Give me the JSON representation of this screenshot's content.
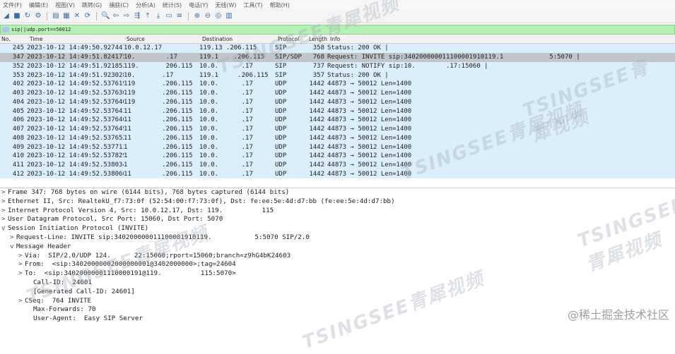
{
  "menu": [
    "文件(F)",
    "编辑(E)",
    "视图(V)",
    "跳转(G)",
    "捕获(C)",
    "分析(A)",
    "统计(S)",
    "电话(Y)",
    "无线(W)",
    "工具(T)",
    "帮助(H)"
  ],
  "filter": {
    "value": "sip||udp.port==50012"
  },
  "columns": {
    "no": "No.",
    "time": "Time",
    "source": "Source",
    "destination": "Destination",
    "protocol": "Protocol",
    "length": "Length",
    "info": "Info"
  },
  "packets": [
    {
      "no": "245",
      "time": "2023-10-12 14:49:50.927447",
      "src": "10.0.12.17",
      "dst": "119.13 .206.115",
      "proto": "SIP",
      "len": "358",
      "info": "Status: 200 OK |"
    },
    {
      "no": "347",
      "time": "2023-10-12 14:49:51.824175",
      "src": "10.        .17",
      "dst": "119.1    .206.115",
      "proto": "SIP/SDP",
      "len": "768",
      "info": "Request: INVITE sip:340200000011100001910119.1            5:5070 |"
    },
    {
      "no": "352",
      "time": "2023-10-12 14:49:51.921852",
      "src": "119.       206.115",
      "dst": "10.0.      .17",
      "proto": "SIP",
      "len": "737",
      "info": "Request: NOTIFY sip:10.        .17:15060 |"
    },
    {
      "no": "353",
      "time": "2023-10-12 14:49:51.923028",
      "src": "10.       .17",
      "dst": "119.1     .206.115",
      "proto": "SIP",
      "len": "357",
      "info": "Status: 200 OK |"
    },
    {
      "no": "402",
      "time": "2023-10-12 14:49:52.537619",
      "src": "119       .206.115",
      "dst": "10.0.      .17",
      "proto": "UDP",
      "len": "1442",
      "info": "44873 → 50012 Len=1400"
    },
    {
      "no": "403",
      "time": "2023-10-12 14:49:52.537636",
      "src": "119       .206.115",
      "dst": "10.0.      .17",
      "proto": "UDP",
      "len": "1442",
      "info": "44873 → 50012 Len=1400"
    },
    {
      "no": "404",
      "time": "2023-10-12 14:49:52.537640",
      "src": "119       .206.115",
      "dst": "10.0.      .17",
      "proto": "UDP",
      "len": "1442",
      "info": "44873 → 50012 Len=1400"
    },
    {
      "no": "405",
      "time": "2023-10-12 14:49:52.537643",
      "src": "11        .206.115",
      "dst": "10.0.      .17",
      "proto": "UDP",
      "len": "1442",
      "info": "44873 → 50012 Len=1400"
    },
    {
      "no": "406",
      "time": "2023-10-12 14:49:52.537646",
      "src": "11        .206.115",
      "dst": "10.0.      .17",
      "proto": "UDP",
      "len": "1442",
      "info": "44873 → 50012 Len=1400"
    },
    {
      "no": "407",
      "time": "2023-10-12 14:49:52.537649",
      "src": "11        .206.115",
      "dst": "10.0.      .17",
      "proto": "UDP",
      "len": "1442",
      "info": "44873 → 50012 Len=1400"
    },
    {
      "no": "408",
      "time": "2023-10-12 14:49:52.537652",
      "src": "11        .206.115",
      "dst": "10.0.      .17",
      "proto": "UDP",
      "len": "1442",
      "info": "44873 → 50012 Len=1400"
    },
    {
      "no": "409",
      "time": "2023-10-12 14:49:52.537713",
      "src": "1         .206.115",
      "dst": "10.0.      .17",
      "proto": "UDP",
      "len": "1442",
      "info": "44873 → 50012 Len=1400"
    },
    {
      "no": "410",
      "time": "2023-10-12 14:49:52.537829",
      "src": "1         .206.115",
      "dst": "10.0.      .17",
      "proto": "UDP",
      "len": "1442",
      "info": "44873 → 50012 Len=1400"
    },
    {
      "no": "411",
      "time": "2023-10-12 14:49:52.538034",
      "src": "1         .206.115",
      "dst": "10.0.      .17",
      "proto": "UDP",
      "len": "1442",
      "info": "44873 → 50012 Len=1400"
    },
    {
      "no": "412",
      "time": "2023-10-12 14:49:52.538066",
      "src": "11        .206.115",
      "dst": "10.0.      .17",
      "proto": "UDP",
      "len": "1442",
      "info": "44873 → 50012 Len=1400"
    }
  ],
  "details": [
    {
      "indent": 0,
      "arrow": ">",
      "text": "Frame 347: 768 bytes on wire (6144 bits), 768 bytes captured (6144 bits)"
    },
    {
      "indent": 0,
      "arrow": ">",
      "text": "Ethernet II, Src: RealtekU_f7:73:0f (52:54:00:f7:73:0f), Dst: fe:ee:5e:4d:d7:bb (fe:ee:5e:4d:d7:bb)"
    },
    {
      "indent": 0,
      "arrow": ">",
      "text": "Internet Protocol Version 4, Src: 10.0.12.17, Dst: 119.          115"
    },
    {
      "indent": 0,
      "arrow": ">",
      "text": "User Datagram Protocol, Src Port: 15060, Dst Port: 5070"
    },
    {
      "indent": 0,
      "arrow": "v",
      "text": "Session Initiation Protocol (INVITE)"
    },
    {
      "indent": 1,
      "arrow": ">",
      "text": "Request-Line: INVITE sip:340200000011100001910119.           5:5070 SIP/2.0"
    },
    {
      "indent": 1,
      "arrow": "v",
      "text": "Message Header"
    },
    {
      "indent": 2,
      "arrow": ">",
      "text": "Via:  SIP/2.0/UDP 124.      22:15060;rport=15060;branch=z9hG4bK24603"
    },
    {
      "indent": 2,
      "arrow": ">",
      "text": "From:  <sip:34020000002000000001@3402000000>;tag=24604"
    },
    {
      "indent": 2,
      "arrow": ">",
      "text": "To:  <sip:34020000001110000191@119.          115:5070>"
    },
    {
      "indent": 3,
      "arrow": "",
      "text": "Call-ID:  24601"
    },
    {
      "indent": 3,
      "arrow": "",
      "text": "[Generated Call-ID: 24601]"
    },
    {
      "indent": 2,
      "arrow": ">",
      "text": "CSeq:  764 INVITE"
    },
    {
      "indent": 3,
      "arrow": "",
      "text": "Max-Forwards: 70"
    },
    {
      "indent": 3,
      "arrow": "",
      "text": "User-Agent:  Easy SIP Server"
    }
  ],
  "watermark": "TSINGSEE青犀视频",
  "corner": "@稀土掘金技术社区"
}
